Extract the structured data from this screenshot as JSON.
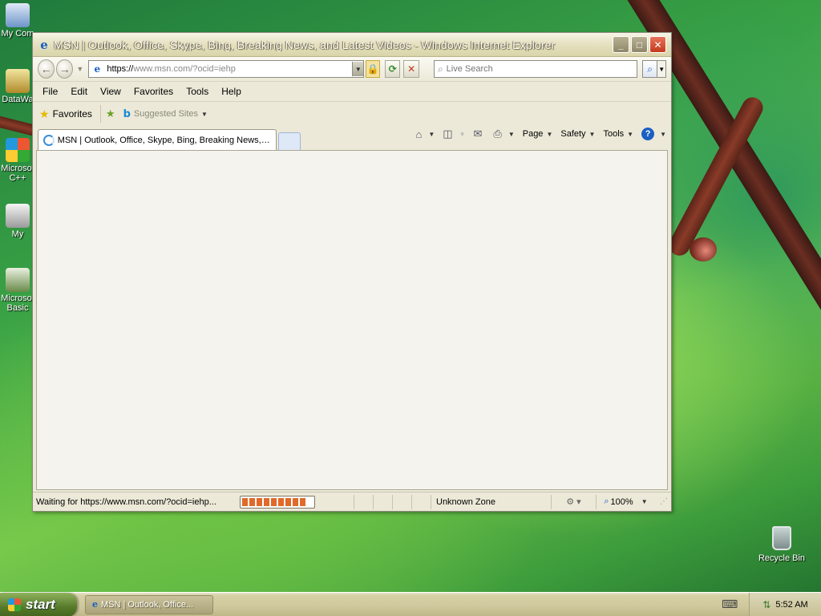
{
  "desktop": {
    "icons": [
      {
        "label": "My Com",
        "icon": "my-computer-icon"
      },
      {
        "label": "DataWa",
        "icon": "dataware-icon"
      },
      {
        "label": "Microsof C++",
        "icon": "cpp-icon"
      },
      {
        "label": "My",
        "icon": "my-icon"
      },
      {
        "label": "Microsof Basic",
        "icon": "basic-icon"
      }
    ],
    "recycle_bin": "Recycle Bin"
  },
  "window": {
    "title": "MSN | Outlook, Office, Skype, Bing, Breaking News, and Latest Videos - Windows Internet Explorer",
    "address": {
      "scheme": "https://",
      "host": "www.msn.com",
      "path": "/?ocid=iehp"
    },
    "search_placeholder": "Live Search",
    "menu": [
      "File",
      "Edit",
      "View",
      "Favorites",
      "Tools",
      "Help"
    ],
    "favorites_label": "Favorites",
    "suggested_sites": "Suggested Sites",
    "tab_title": "MSN | Outlook, Office, Skype, Bing, Breaking News, a...",
    "commands": {
      "page": "Page",
      "safety": "Safety",
      "tools": "Tools"
    },
    "status": {
      "text": "Waiting for https://www.msn.com/?ocid=iehp...",
      "progress_percent": 90,
      "zone": "Unknown Zone",
      "zoom": "100%"
    }
  },
  "taskbar": {
    "start_label": "start",
    "task_label": "MSN | Outlook, Office...",
    "clock": "5:52 AM"
  },
  "colors": {
    "ie_blue": "#1a5fc4",
    "progress": "#e06a2a",
    "start_green": "#567a2a"
  }
}
